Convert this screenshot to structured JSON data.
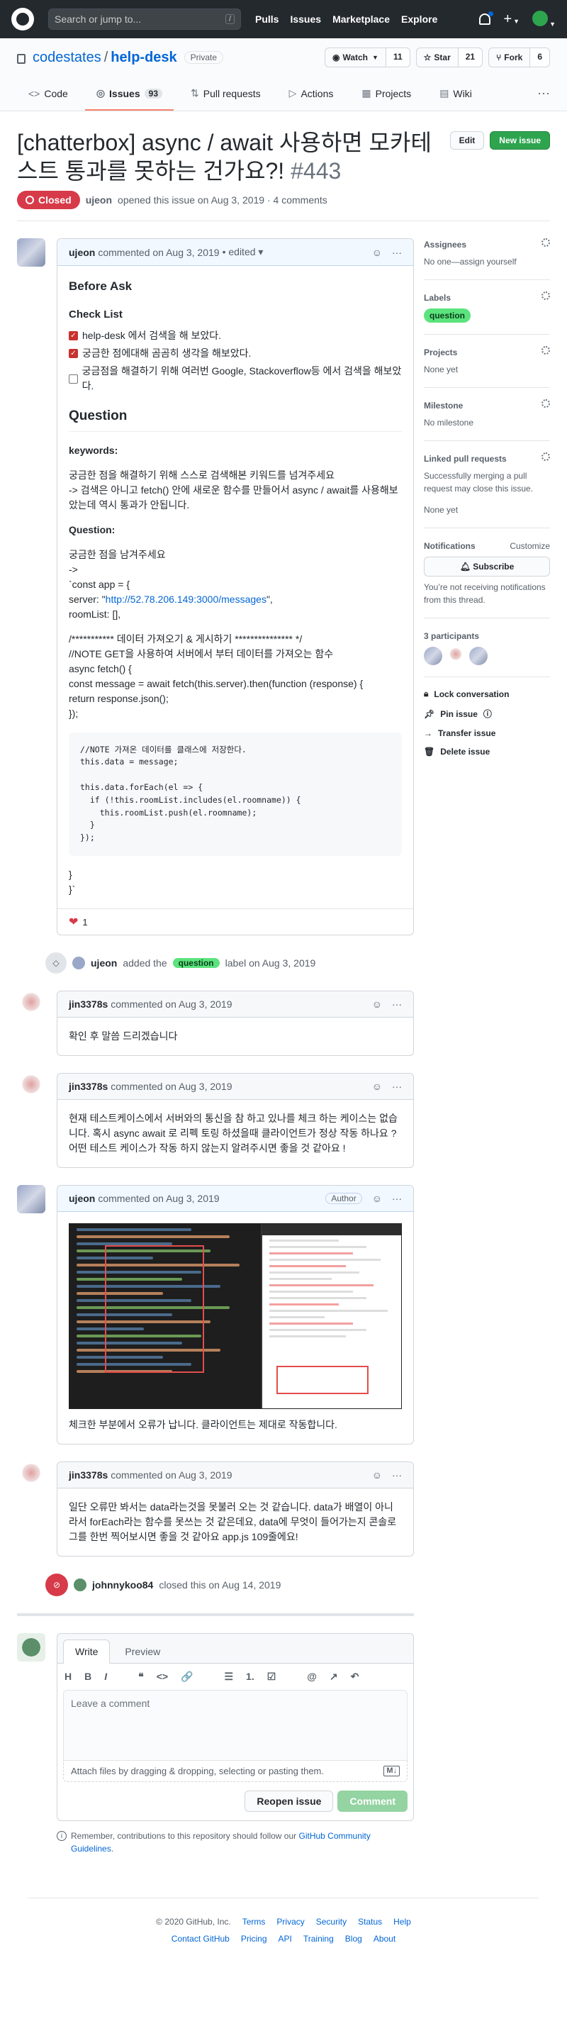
{
  "header": {
    "search_placeholder": "Search or jump to...",
    "slash": "/",
    "nav": [
      "Pulls",
      "Issues",
      "Marketplace",
      "Explore"
    ]
  },
  "repo": {
    "owner": "codestates",
    "name": "help-desk",
    "sep": "/",
    "visibility": "Private",
    "watch_label": "Watch",
    "watch_count": "11",
    "star_label": "Star",
    "star_count": "21",
    "fork_label": "Fork",
    "fork_count": "6"
  },
  "tabs": [
    {
      "label": "Code",
      "icon": "code-icon"
    },
    {
      "label": "Issues",
      "icon": "issue-icon",
      "count": "93"
    },
    {
      "label": "Pull requests",
      "icon": "pr-icon"
    },
    {
      "label": "Actions",
      "icon": "actions-icon"
    },
    {
      "label": "Projects",
      "icon": "projects-icon"
    },
    {
      "label": "Wiki",
      "icon": "wiki-icon"
    }
  ],
  "issue": {
    "title": "[chatterbox] async / await 사용하면 모카테스트 통과를 못하는 건가요?!",
    "number": "#443",
    "edit_label": "Edit",
    "new_issue_label": "New issue",
    "state": "Closed",
    "author": "ujeon",
    "meta_text": "opened this issue on Aug 3, 2019 · 4 comments"
  },
  "comments": {
    "c1": {
      "author": "ujeon",
      "meta": "commented on Aug 3, 2019",
      "edited": "• edited ▾",
      "h_before": "Before Ask",
      "h_checklist": "Check List",
      "checks": [
        "help-desk 에서 검색을 해 보았다.",
        "궁금한 점에대해 곰곰히 생각을 해보았다.",
        "궁금점을 해결하기 위해 여러번 Google, Stackoverflow등 에서 검색을 해보았다."
      ],
      "h_question": "Question",
      "kw_label": "keywords:",
      "kw_text": "궁금한 점을 해결하기 위해 스스로 검색해본 키워드를 넘겨주세요\n-> 검색은 아니고 fetch() 안에 새로운 함수를 만들어서 async / await를 사용해보았는데 역시 통과가 안됩니다.",
      "q_label": "Question:",
      "q_text1": "궁금한 점을 남겨주세요\n->\n`const app = {",
      "q_server_prefix": "server: \"",
      "q_server_url": "http://52.78.206.149:3000/messages",
      "q_server_suffix": "\",",
      "q_text2": "roomList: [],",
      "q_text3": "/*********** 데이터 가져오기 & 게시하기 *************** */\n//NOTE GET을 사용하여 서버에서 부터 데이터를 가져오는 함수\nasync fetch() {\nconst message = await fetch(this.server).then(function (response) {\nreturn response.json();\n});",
      "code": "//NOTE 가져온 데이터를 클래스에 저장한다.\nthis.data = message;\n\nthis.data.forEach(el => {\n  if (!this.roomList.includes(el.roomname)) {\n    this.roomList.push(el.roomname);\n  }\n});",
      "q_text4": "}\n}`",
      "reaction_count": "1"
    },
    "label_event": {
      "user": "ujeon",
      "pre": "added the",
      "label": "question",
      "post": "label on Aug 3, 2019"
    },
    "c2": {
      "author": "jin3378s",
      "meta": "commented on Aug 3, 2019",
      "body": "확인 후 말씀 드리겠습니다"
    },
    "c3": {
      "author": "jin3378s",
      "meta": "commented on Aug 3, 2019",
      "body": "현재 테스트케이스에서 서버와의 통신을 참 하고 있나를 체크 하는 케이스는 없습니다. 혹시 async await 로 리펙 토링 하셨을때 클라이언트가 정상 작동 하나요 ? 어떤 테스트 케이스가 작동 하지 않는지 알려주시면 좋을 것 같아요 !"
    },
    "c4": {
      "author": "ujeon",
      "meta": "commented on Aug 3, 2019",
      "badge": "Author",
      "body": "체크한 부분에서 오류가 납니다. 클라이언트는 제대로 작동합니다."
    },
    "c5": {
      "author": "jin3378s",
      "meta": "commented on Aug 3, 2019",
      "body": "일단 오류만 봐서는 data라는것을 못불러 오는 것 같습니다. data가 배열이 아니라서 forEach라는 함수를 못쓰는 것 같은데요, data에 무엇이 들어가는지 콘솔로그를 한번 찍어보시면 좋을 것 같아요 app.js 109줄에요!"
    },
    "closed_event": {
      "user": "johnnykoo84",
      "text": "closed this on Aug 14, 2019"
    }
  },
  "composer": {
    "tab_write": "Write",
    "tab_preview": "Preview",
    "toolbar": [
      "H",
      "B",
      "I",
      "❝",
      "<>",
      "🔗",
      "☰",
      "1.",
      "☑",
      "@",
      "↗",
      "↶"
    ],
    "placeholder": "Leave a comment",
    "attach": "Attach files by dragging & dropping, selecting or pasting them.",
    "md": "M↓",
    "reopen": "Reopen issue",
    "comment": "Comment",
    "remember_pre": "Remember, contributions to this repository should follow our ",
    "remember_link": "GitHub Community Guidelines",
    "remember_post": "."
  },
  "sidebar": {
    "assignees_h": "Assignees",
    "assignees_v": "No one—assign yourself",
    "labels_h": "Labels",
    "label_q": "question",
    "projects_h": "Projects",
    "projects_v": "None yet",
    "milestone_h": "Milestone",
    "milestone_v": "No milestone",
    "linked_h": "Linked pull requests",
    "linked_desc": "Successfully merging a pull request may close this issue.",
    "linked_v": "None yet",
    "notif_h": "Notifications",
    "notif_custom": "Customize",
    "subscribe": "Subscribe",
    "notif_desc": "You’re not receiving notifications from this thread.",
    "participants_h": "3 participants",
    "lock": "Lock conversation",
    "pin": "Pin issue",
    "transfer": "Transfer issue",
    "delete": "Delete issue"
  },
  "footer": {
    "copyright": "© 2020 GitHub, Inc.",
    "row1": [
      "Terms",
      "Privacy",
      "Security",
      "Status",
      "Help"
    ],
    "row2": [
      "Contact GitHub",
      "Pricing",
      "API",
      "Training",
      "Blog",
      "About"
    ]
  }
}
